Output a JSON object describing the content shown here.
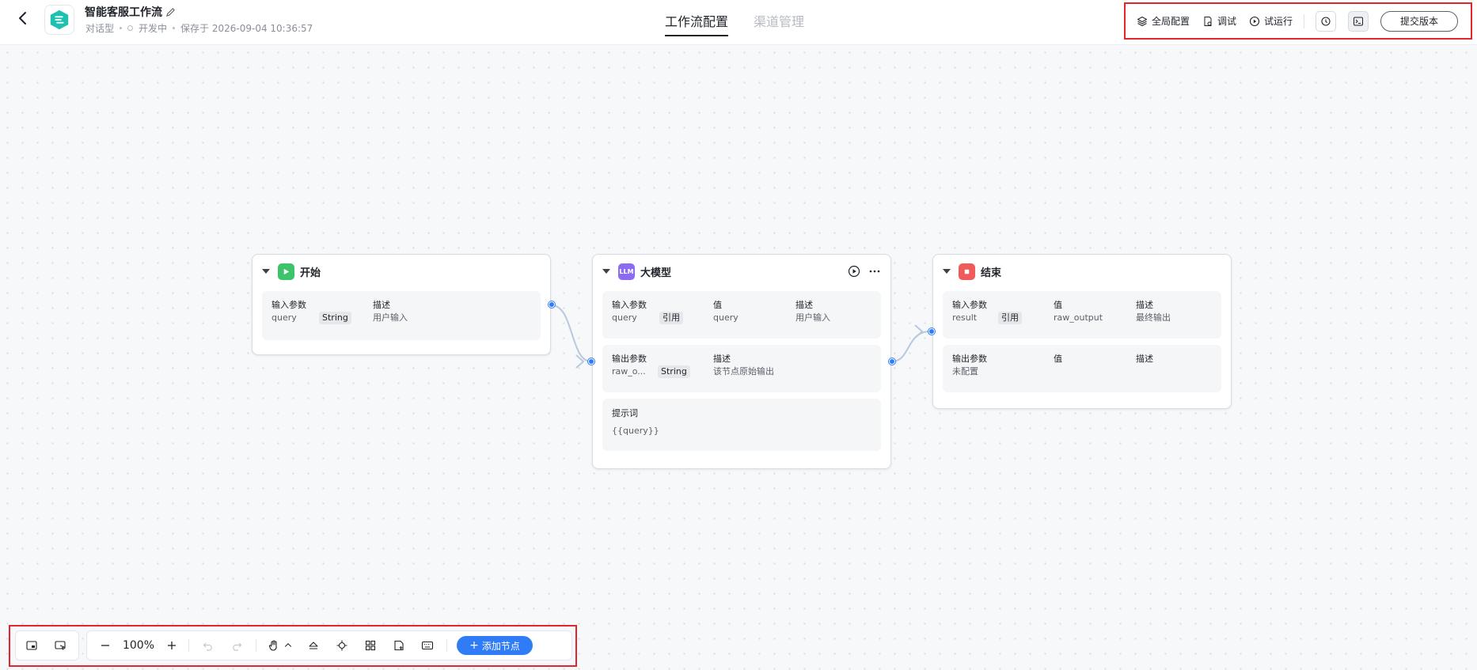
{
  "header": {
    "app_name": "智能客服工作流",
    "app_type": "对话型",
    "status": "开发中",
    "saved_at": "保存于 2026-09-04 10:36:57",
    "tabs": [
      {
        "label": "工作流配置",
        "active": true
      },
      {
        "label": "渠道管理",
        "active": false
      }
    ],
    "actions": {
      "global_config": "全局配置",
      "debug": "调试",
      "trial_run": "试运行",
      "submit": "提交版本"
    }
  },
  "nodes": {
    "start": {
      "title": "开始",
      "icon": "play-icon",
      "color": "#3bc46a",
      "inputs": {
        "col_param": "输入参数",
        "col_desc": "描述",
        "param": "query",
        "type": "String",
        "desc": "用户输入"
      }
    },
    "llm": {
      "title": "大模型",
      "icon": "llm-icon",
      "icon_text": "LLM",
      "color": "#8b6cf0",
      "inputs": {
        "col_param": "输入参数",
        "col_value": "值",
        "col_desc": "描述",
        "param": "query",
        "tag": "引用",
        "value": "query",
        "desc": "用户输入"
      },
      "outputs": {
        "col_param": "输出参数",
        "col_desc": "描述",
        "param": "raw_o...",
        "type": "String",
        "desc": "该节点原始输出"
      },
      "prompt": {
        "label": "提示词",
        "value": "{{query}}"
      }
    },
    "end": {
      "title": "结束",
      "icon": "stop-icon",
      "color": "#ef5a5a",
      "inputs": {
        "col_param": "输入参数",
        "col_value": "值",
        "col_desc": "描述",
        "param": "result",
        "tag": "引用",
        "value": "raw_output",
        "desc": "最终输出"
      },
      "outputs": {
        "col_param": "输出参数",
        "col_value": "值",
        "col_desc": "描述",
        "empty": "未配置"
      }
    }
  },
  "bottom_toolbar": {
    "zoom": "100%",
    "add_node": "添加节点"
  },
  "colors": {
    "accent": "#2f7cf6",
    "highlight_frame": "#e1272d"
  }
}
